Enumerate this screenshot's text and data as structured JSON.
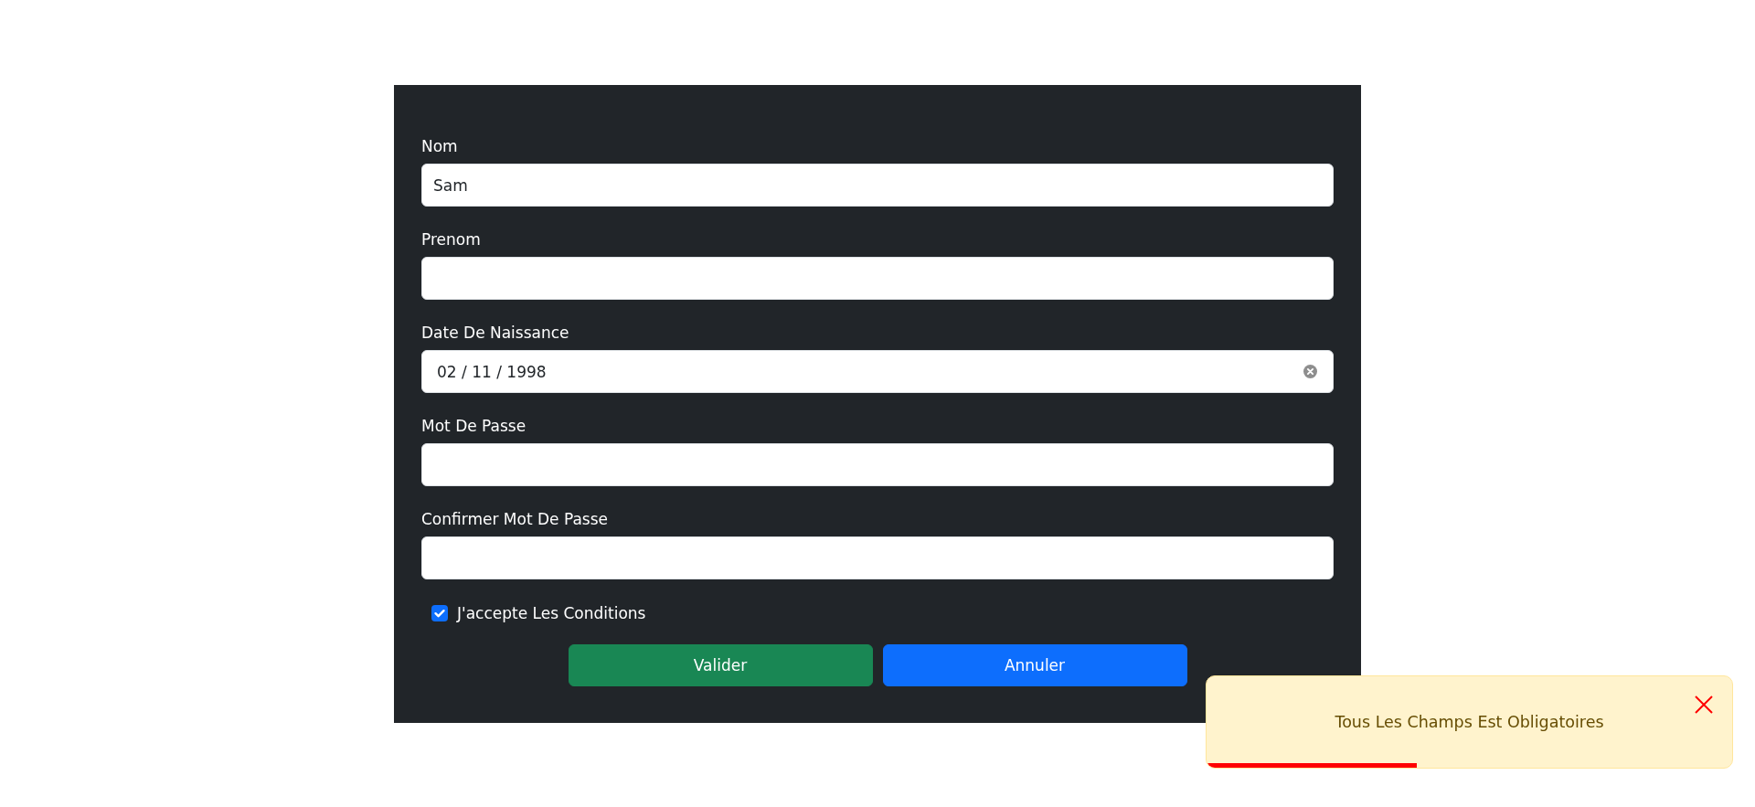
{
  "form": {
    "fields": [
      {
        "kind": "text",
        "label": "Nom",
        "value": "Sam"
      },
      {
        "kind": "text",
        "label": "Prenom"
      },
      {
        "kind": "date",
        "label": "Date De Naissance",
        "value": "02 / 11 / 1998"
      },
      {
        "kind": "password",
        "label": "Mot De Passe"
      },
      {
        "kind": "password",
        "label": "Confirmer Mot De Passe"
      }
    ],
    "terms": {
      "label": "J'accepte Les Conditions",
      "checked": true
    },
    "buttons": [
      {
        "label": "Valider",
        "color": "#198754"
      },
      {
        "label": "Annuler",
        "color": "#0d6efd"
      }
    ]
  },
  "toast": {
    "message": "Tous Les Champs Est Obligatoires",
    "level": 0.4
  }
}
